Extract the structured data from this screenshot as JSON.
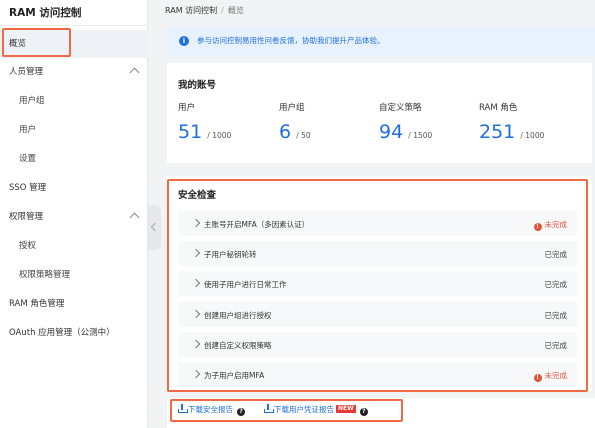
{
  "sidebar": {
    "title": "RAM 访问控制",
    "items": [
      {
        "label": "概览"
      },
      {
        "label": "人员管理"
      },
      {
        "label": "用户组"
      },
      {
        "label": "用户"
      },
      {
        "label": "设置"
      },
      {
        "label": "SSO 管理"
      },
      {
        "label": "权限管理"
      },
      {
        "label": "授权"
      },
      {
        "label": "权限策略管理"
      },
      {
        "label": "RAM 角色管理"
      },
      {
        "label": "OAuth 应用管理（公测中）"
      }
    ]
  },
  "breadcrumb": {
    "root": "RAM 访问控制",
    "sep": "/",
    "current": "概览"
  },
  "notice": {
    "text": "参与访问控制易用性问卷反馈，协助我们提升产品体验。"
  },
  "account": {
    "title": "我的账号",
    "stats": [
      {
        "label": "用户",
        "value": "51",
        "limit": "/ 1000"
      },
      {
        "label": "用户组",
        "value": "6",
        "limit": "/ 50"
      },
      {
        "label": "自定义策略",
        "value": "94",
        "limit": "/ 1500"
      },
      {
        "label": "RAM 角色",
        "value": "251",
        "limit": "/ 1000"
      }
    ]
  },
  "security": {
    "title": "安全检查",
    "rows": [
      {
        "label": "主账号开启MFA（多因素认证）",
        "status": "未完成"
      },
      {
        "label": "子用户秘钥轮转",
        "status": "已完成"
      },
      {
        "label": "使用子用户进行日常工作",
        "status": "已完成"
      },
      {
        "label": "创建用户组进行授权",
        "status": "已完成"
      },
      {
        "label": "创建自定义权限策略",
        "status": "已完成"
      },
      {
        "label": "为子用户启用MFA",
        "status": "未完成"
      }
    ]
  },
  "downloads": {
    "security_report": "下载安全报告",
    "credential_report": "下载用户凭证报告",
    "new_badge": "NEW",
    "help": "?"
  },
  "icons": {
    "info": "i",
    "warn": "!"
  },
  "colors": {
    "accent": "#1f6fe0",
    "warning": "#e0553a",
    "highlight": "#f06a43"
  }
}
